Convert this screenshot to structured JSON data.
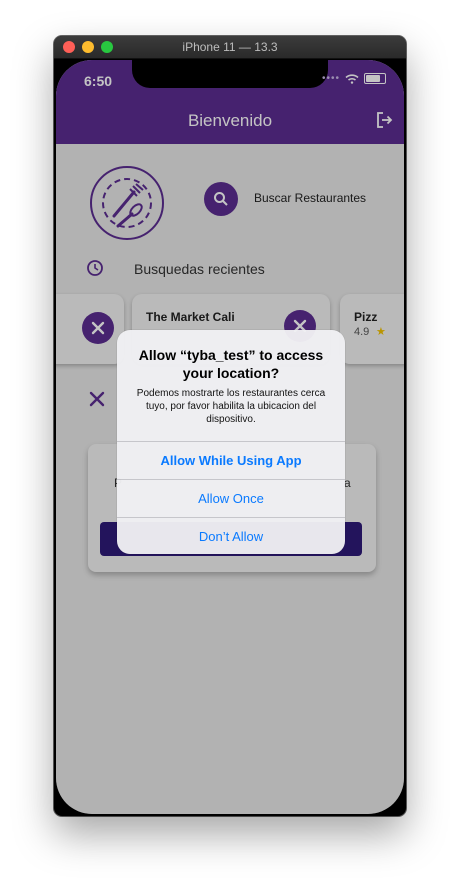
{
  "window": {
    "title": "iPhone 11 — 13.3"
  },
  "status_bar": {
    "time": "6:50"
  },
  "app_bar": {
    "title": "Bienvenido",
    "action_icon": "logout-icon"
  },
  "home": {
    "search_label": "Buscar Restaurantes",
    "recent_label": "Busquedas recientes",
    "recent_cards": [
      {
        "name": "The Market Cali"
      },
      {
        "name": "Pizz",
        "rating": "4.9"
      }
    ],
    "panel": {
      "left_fragment": "P",
      "right_fragment": "a"
    }
  },
  "alert": {
    "title": "Allow “tyba_test” to access your location?",
    "message": "Podemos mostrarte los restaurantes cerca tuyo, por favor habilita la ubicacion del dispositivo.",
    "buttons": [
      "Allow While Using App",
      "Allow Once",
      "Don’t Allow"
    ]
  },
  "colors": {
    "primary": "#5b2d91",
    "dark_button": "#2e1a78",
    "ios_blue": "#0a7aff"
  }
}
